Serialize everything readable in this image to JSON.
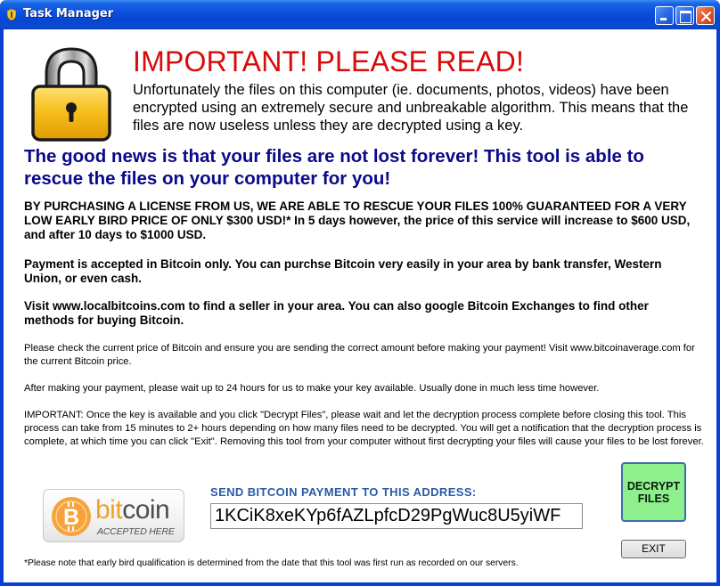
{
  "window": {
    "title": "Task Manager",
    "title_icon": "shield-icon",
    "controls": {
      "minimize": "minimize-icon",
      "maximize": "maximize-icon",
      "close": "close-icon"
    }
  },
  "header": {
    "icon": "padlock-icon",
    "headline": "IMPORTANT!  PLEASE READ!",
    "intro": "Unfortunately the files on this computer (ie. documents, photos, videos) have been encrypted using an extremely secure and unbreakable algorithm.  This means that the files are now useless unless they are decrypted using a key."
  },
  "good_news": "The good news is that your files are not lost forever!  This tool is able to rescue the files on your computer for you!",
  "paragraphs_bold": [
    "BY PURCHASING A LICENSE FROM US, WE ARE ABLE TO RESCUE YOUR FILES 100% GUARANTEED FOR A VERY LOW EARLY BIRD PRICE OF ONLY $300 USD!*  In 5 days however, the price of this service will increase to $600 USD, and after 10 days to $1000 USD.",
    "Payment is accepted in Bitcoin only.  You can purchse Bitcoin very easily in your area by bank transfer, Western Union, or even cash.",
    "Visit www.localbitcoins.com to find a seller in your area.  You can also google Bitcoin Exchanges to find other methods for buying Bitcoin."
  ],
  "paragraphs_small": [
    "Please check the current price of Bitcoin and ensure you are sending the correct amount before making your payment!  Visit www.bitcoinaverage.com for the current Bitcoin price.",
    "After making your payment, please wait up to 24 hours for us to make your key available.  Usually done in much less time however.",
    "IMPORTANT:  Once the key is available and you click \"Decrypt Files\", please wait and let the decryption process complete before closing this tool.  This process can take from 15 minutes to 2+ hours depending on how many files need to be decrypted.  You will get a notification that the decryption process is complete, at which time you can click \"Exit\".  Removing this tool from your computer without first decrypting your files will cause your files to be lost forever."
  ],
  "bitcoin_badge": {
    "word_part1": "bit",
    "word_part2": "coin",
    "subtitle": "ACCEPTED HERE",
    "coin_symbol": "B",
    "colors": {
      "orange": "#f0a02a",
      "gray": "#4d4d4d"
    }
  },
  "payment": {
    "label": "SEND BITCOIN PAYMENT TO THIS ADDRESS:",
    "address": "1KCiK8xeKYp6fAZLpfcD29PgWuc8U5yiWF"
  },
  "buttons": {
    "decrypt_line1": "DECRYPT",
    "decrypt_line2": "FILES",
    "exit": "EXIT"
  },
  "footnote": "*Please note that early bird qualification is determined from the date that this tool was first run as recorded on our servers.",
  "colors": {
    "headline": "#d80a0a",
    "good_news": "#0a0a8a",
    "address_label": "#2a5aa6",
    "decrypt_button": "#8df08d",
    "titlebar": "#0a4fdc"
  }
}
